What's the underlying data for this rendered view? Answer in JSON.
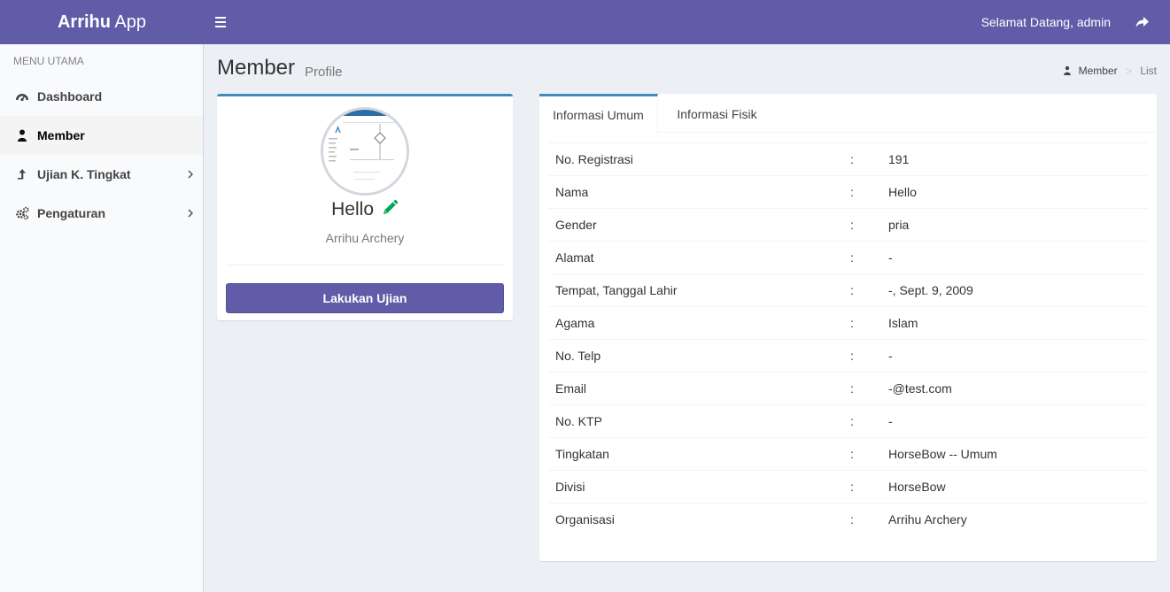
{
  "header": {
    "logo_bold": "Arrihu",
    "logo_light": "App",
    "welcome": "Selamat Datang, admin"
  },
  "sidebar": {
    "menu_header": "MENU UTAMA",
    "items": [
      {
        "label": "Dashboard",
        "icon": "dashboard-icon"
      },
      {
        "label": "Member",
        "icon": "user-icon",
        "active": true
      },
      {
        "label": "Ujian K. Tingkat",
        "icon": "level-up-icon",
        "has_submenu": true
      },
      {
        "label": "Pengaturan",
        "icon": "gears-icon",
        "has_submenu": true
      }
    ]
  },
  "content_header": {
    "title": "Member",
    "subtitle": "Profile",
    "breadcrumb": [
      "Member",
      "List"
    ]
  },
  "profile": {
    "name": "Hello",
    "organization": "Arrihu Archery",
    "action_label": "Lakukan Ujian"
  },
  "tabs": [
    {
      "label": "Informasi Umum",
      "active": true
    },
    {
      "label": "Informasi Fisik",
      "active": false
    }
  ],
  "info": {
    "separator": ":",
    "rows": [
      {
        "key": "No. Registrasi",
        "value": "191"
      },
      {
        "key": "Nama",
        "value": "Hello"
      },
      {
        "key": "Gender",
        "value": "pria"
      },
      {
        "key": "Alamat",
        "value": "-"
      },
      {
        "key": "Tempat, Tanggal Lahir",
        "value": "-, Sept. 9, 2009"
      },
      {
        "key": "Agama",
        "value": "Islam"
      },
      {
        "key": "No. Telp",
        "value": "-"
      },
      {
        "key": "Email",
        "value": "-@test.com"
      },
      {
        "key": "No. KTP",
        "value": "-"
      },
      {
        "key": "Tingkatan",
        "value": "HorseBow -- Umum"
      },
      {
        "key": "Divisi",
        "value": "HorseBow"
      },
      {
        "key": "Organisasi",
        "value": "Arrihu Archery"
      }
    ]
  },
  "colors": {
    "brand": "#605ca8",
    "tab_accent": "#3c8dbc",
    "edit_icon": "#00a65a"
  }
}
